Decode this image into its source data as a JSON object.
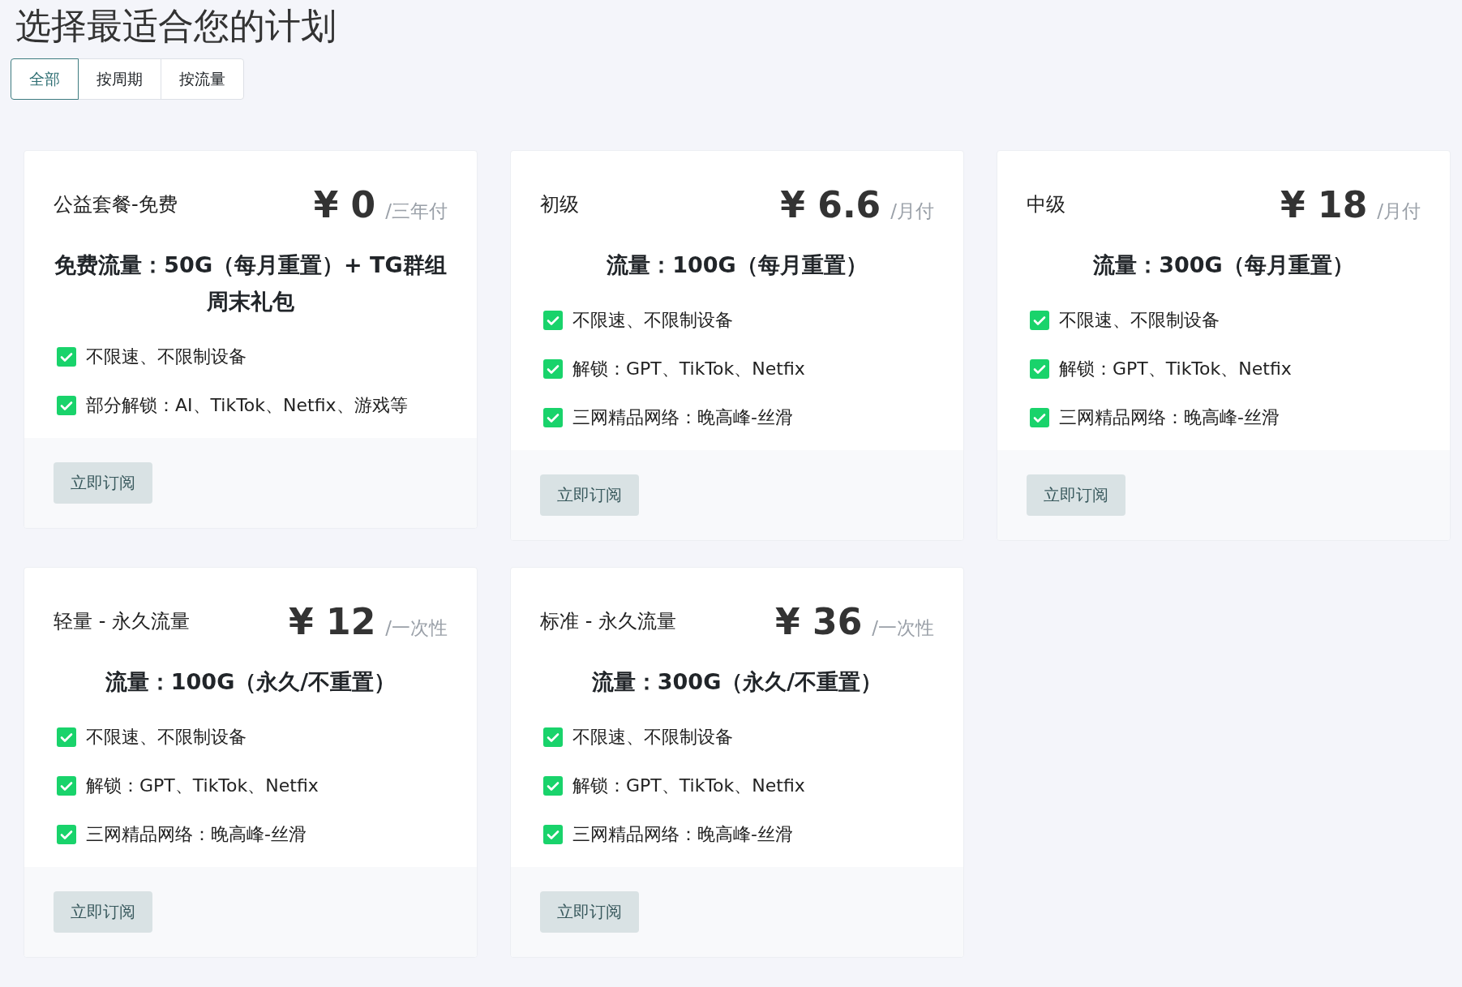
{
  "title": "选择最适合您的计划",
  "tabs": [
    {
      "label": "全部",
      "selected": true
    },
    {
      "label": "按周期",
      "selected": false
    },
    {
      "label": "按流量",
      "selected": false
    }
  ],
  "plans": [
    {
      "name": "公益套餐-免费",
      "price": "¥ 0",
      "period": "/三年付",
      "headline": "免费流量：50G（每月重置）+ TG群组周末礼包",
      "features": [
        {
          "text": "不限速、不限制设备",
          "checked": true
        },
        {
          "text": "部分解锁：AI、TikTok、Netfix、游戏等",
          "checked": true
        }
      ],
      "button": "立即订阅"
    },
    {
      "name": "初级",
      "price": "¥ 6.6",
      "period": "/月付",
      "headline": "流量：100G（每月重置）",
      "features": [
        {
          "text": "不限速、不限制设备",
          "checked": true
        },
        {
          "text": "解锁：GPT、TikTok、Netfix",
          "checked": true
        },
        {
          "text": "三网精品网络：晚高峰-丝滑",
          "checked": true
        }
      ],
      "button": "立即订阅"
    },
    {
      "name": "中级",
      "price": "¥ 18",
      "period": "/月付",
      "headline": "流量：300G（每月重置）",
      "features": [
        {
          "text": "不限速、不限制设备",
          "checked": true
        },
        {
          "text": "解锁：GPT、TikTok、Netfix",
          "checked": true
        },
        {
          "text": "三网精品网络：晚高峰-丝滑",
          "checked": true
        }
      ],
      "button": "立即订阅"
    },
    {
      "name": "轻量 - 永久流量",
      "price": "¥ 12",
      "period": "/一次性",
      "headline": "流量：100G（永久/不重置）",
      "features": [
        {
          "text": "不限速、不限制设备",
          "checked": true
        },
        {
          "text": "解锁：GPT、TikTok、Netfix",
          "checked": true
        },
        {
          "text": "三网精品网络：晚高峰-丝滑",
          "checked": true
        }
      ],
      "button": "立即订阅"
    },
    {
      "name": "标准 - 永久流量",
      "price": "¥ 36",
      "period": "/一次性",
      "headline": "流量：300G（永久/不重置）",
      "features": [
        {
          "text": "不限速、不限制设备",
          "checked": true
        },
        {
          "text": "解锁：GPT、TikTok、Netfix",
          "checked": true
        },
        {
          "text": "三网精品网络：晚高峰-丝滑",
          "checked": true
        }
      ],
      "button": "立即订阅"
    }
  ]
}
